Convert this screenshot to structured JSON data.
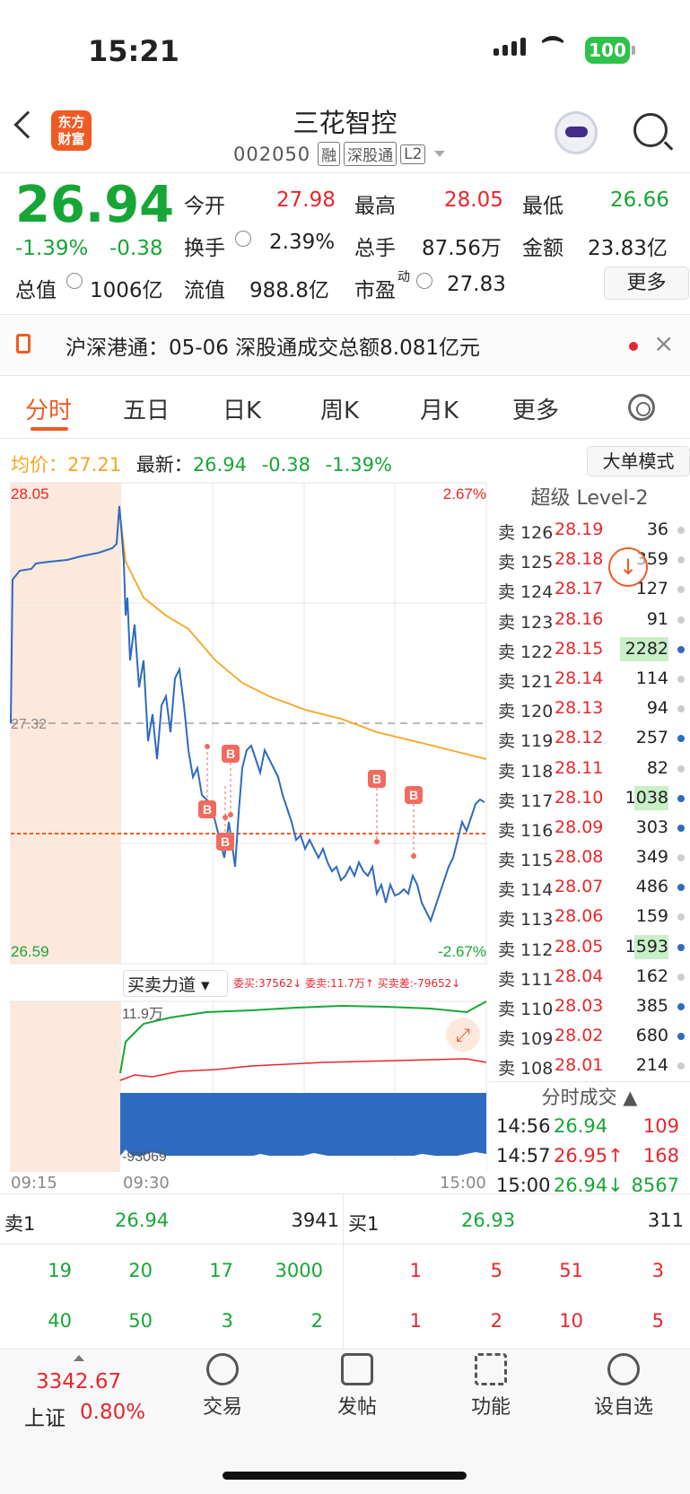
{
  "status": {
    "time": "15:21",
    "battery": "100"
  },
  "header": {
    "logo_line1": "东方",
    "logo_line2": "财富",
    "title": "三花智控",
    "code": "002050",
    "tags": [
      "融",
      "深股通",
      "L2"
    ]
  },
  "quote": {
    "price": "26.94",
    "pct": "-1.39%",
    "chg": "-0.38",
    "open_label": "今开",
    "open": "27.98",
    "high_label": "最高",
    "high": "28.05",
    "low_label": "最低",
    "low": "26.66",
    "turnover_label": "换手",
    "turnover": "2.39%",
    "vol_label": "总手",
    "vol": "87.56万",
    "amt_label": "金额",
    "amt": "23.83亿",
    "mcap_label": "总值",
    "mcap": "1006亿",
    "float_label": "流值",
    "float": "988.8亿",
    "pe_label": "市盈",
    "pe_sup": "动",
    "pe": "27.83",
    "more": "更多"
  },
  "notice": {
    "text": "沪深港通：05-06 深股通成交总额8.081亿元"
  },
  "tabs": [
    "分时",
    "五日",
    "日K",
    "周K",
    "月K",
    "更多"
  ],
  "info": {
    "avg_label": "均价：",
    "avg": "27.21",
    "new_label": "最新：",
    "new": "26.94",
    "chg": "-0.38",
    "pct": "-1.39%",
    "mode": "大单模式"
  },
  "chart_labels": {
    "top": "28.05",
    "mid": "27.32",
    "bottom": "26.59",
    "top_pct": "2.67%",
    "bottom_pct": "-2.67%",
    "t1": "09:15",
    "t2": "09:30",
    "t3": "15:00",
    "sub_title": "买卖力道",
    "sub_stats": "委买:37562↓ 委卖:11.7万↑ 买卖差:-79652↓",
    "sub_max": "11.9万",
    "sub_min": "-93069"
  },
  "level2": {
    "title": "超级 Level-2",
    "rows": [
      [
        "卖 126",
        "28.19",
        "36"
      ],
      [
        "卖 125",
        "28.18",
        "359"
      ],
      [
        "卖 124",
        "28.17",
        "127"
      ],
      [
        "卖 123",
        "28.16",
        "91"
      ],
      [
        "卖 122",
        "28.15",
        "2282"
      ],
      [
        "卖 121",
        "28.14",
        "114"
      ],
      [
        "卖 120",
        "28.13",
        "94"
      ],
      [
        "卖 119",
        "28.12",
        "257"
      ],
      [
        "卖 118",
        "28.11",
        "82"
      ],
      [
        "卖 117",
        "28.10",
        "1038"
      ],
      [
        "卖 116",
        "28.09",
        "303"
      ],
      [
        "卖 115",
        "28.08",
        "349"
      ],
      [
        "卖 114",
        "28.07",
        "486"
      ],
      [
        "卖 113",
        "28.06",
        "159"
      ],
      [
        "卖 112",
        "28.05",
        "1593"
      ],
      [
        "卖 111",
        "28.04",
        "162"
      ],
      [
        "卖 110",
        "28.03",
        "385"
      ],
      [
        "卖 109",
        "28.02",
        "680"
      ],
      [
        "卖 108",
        "28.01",
        "214"
      ]
    ],
    "trade_title": "分时成交",
    "trades": [
      [
        "14:56",
        "26.94",
        "109"
      ],
      [
        "14:57",
        "26.95↑",
        "168"
      ],
      [
        "15:00",
        "26.94↓",
        "8567"
      ]
    ]
  },
  "orderbook": {
    "sell_label": "卖1",
    "sell_price": "26.94",
    "sell_vol": "3941",
    "buy_label": "买1",
    "buy_price": "26.93",
    "buy_vol": "311",
    "sell_q1": [
      "19",
      "20",
      "17",
      "3000"
    ],
    "sell_q2": [
      "40",
      "50",
      "3",
      "2"
    ],
    "buy_q1": [
      "1",
      "5",
      "51",
      "3"
    ],
    "buy_q2": [
      "1",
      "2",
      "10",
      "5"
    ]
  },
  "footer": {
    "index": "3342.67",
    "index_name": "上证",
    "index_pct": "0.80%",
    "items": [
      "交易",
      "发帖",
      "功能",
      "设自选"
    ]
  },
  "colors": {
    "accent": "#ef5b22",
    "up": "#e8262c",
    "down": "#17a636",
    "price_line": "#2e6bbf",
    "avg_line": "#f5a623"
  }
}
